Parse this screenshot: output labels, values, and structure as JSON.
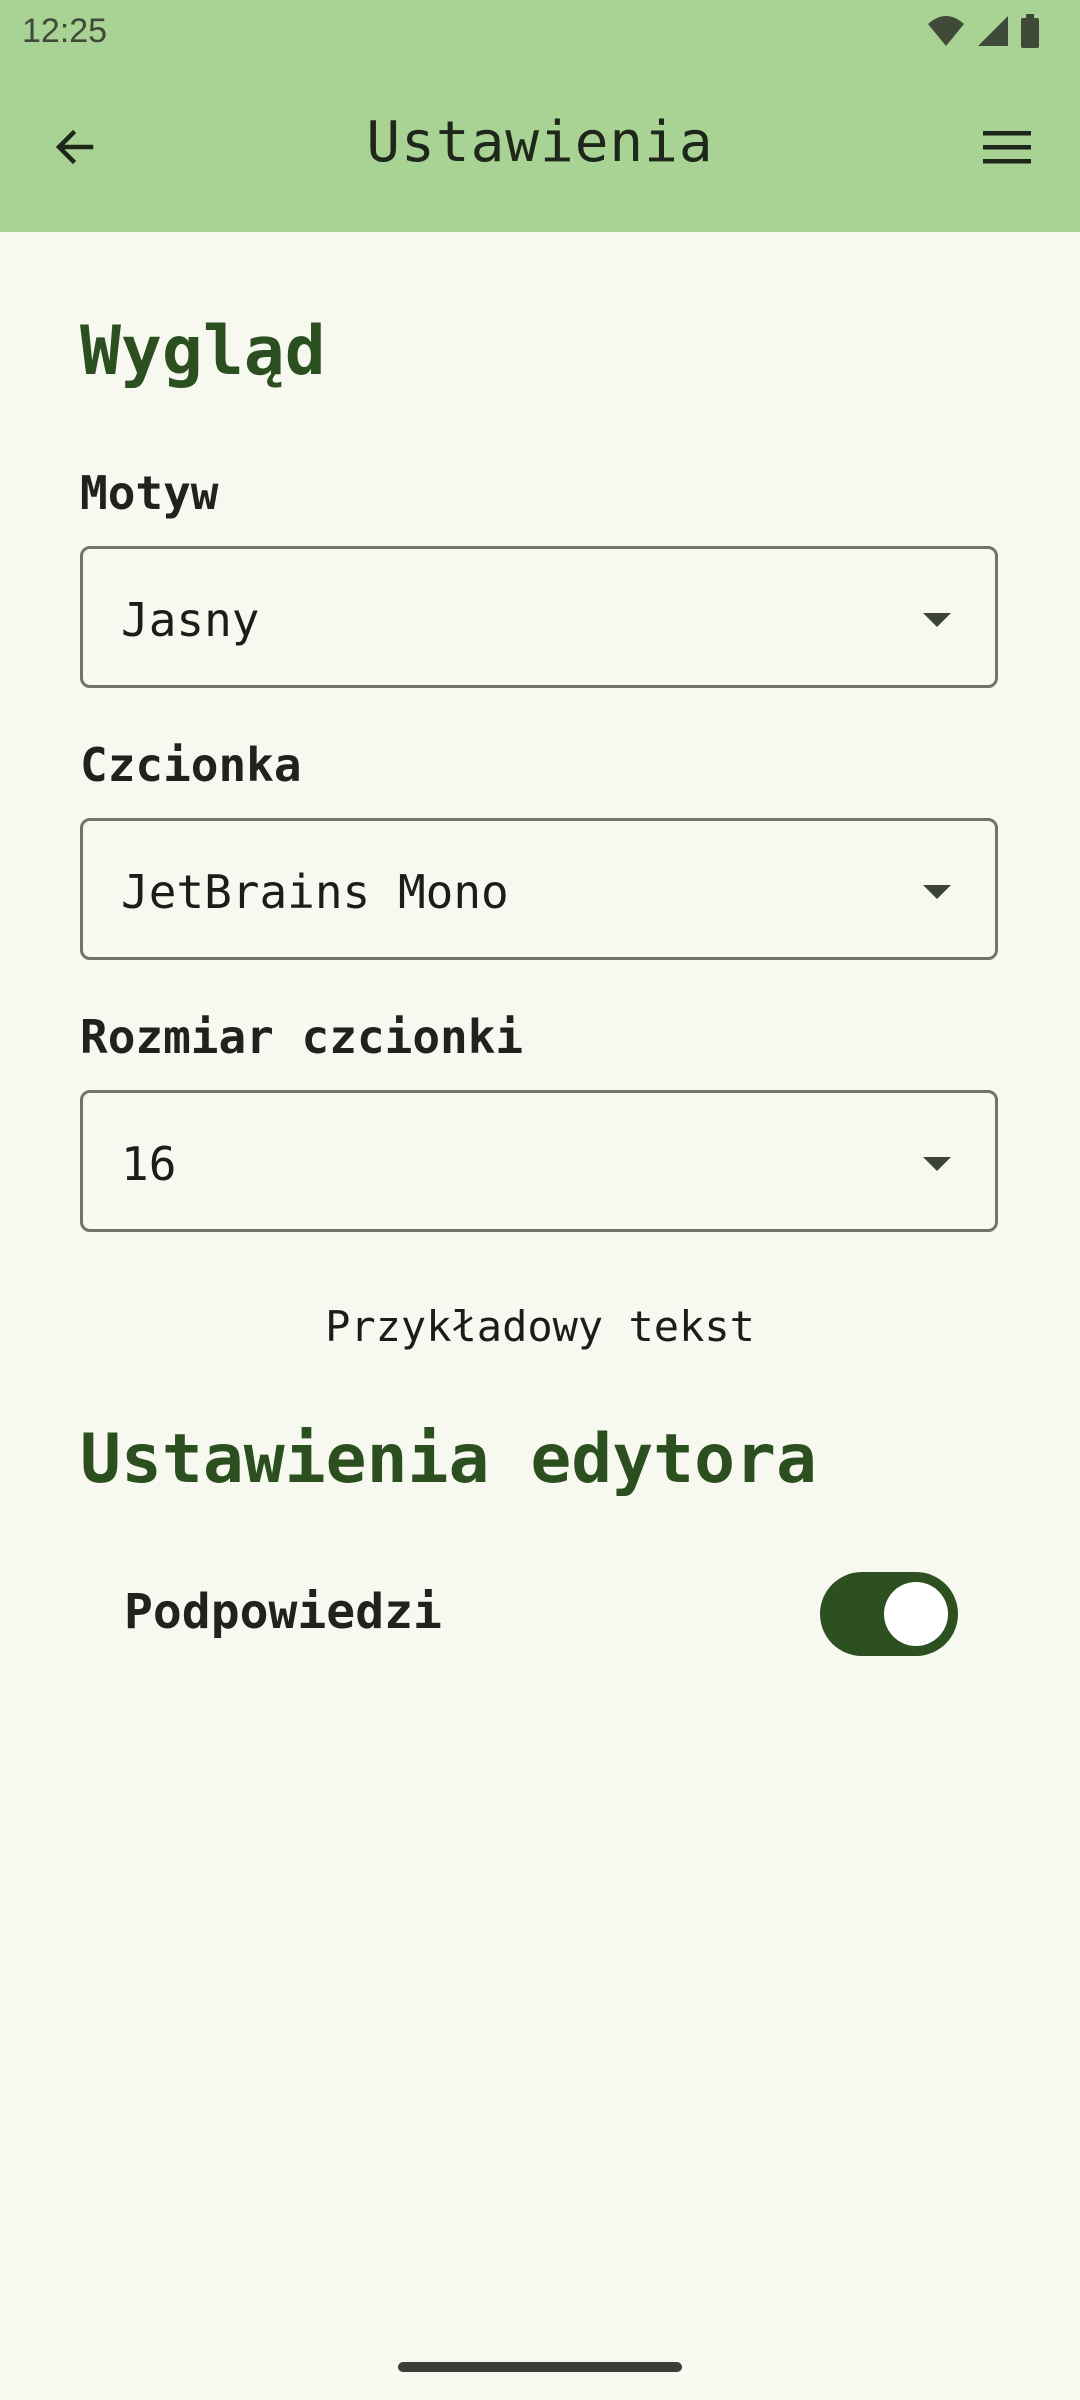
{
  "status_bar": {
    "time": "12:25",
    "icons": [
      "wifi-icon",
      "cell-signal-icon",
      "battery-icon"
    ]
  },
  "app_bar": {
    "title": "Ustawienia",
    "back_icon": "arrow-left-icon",
    "menu_icon": "hamburger-menu-icon"
  },
  "appearance": {
    "section_title": "Wygląd",
    "theme": {
      "label": "Motyw",
      "value": "Jasny"
    },
    "font": {
      "label": "Czcionka",
      "value": "JetBrains Mono"
    },
    "font_size": {
      "label": "Rozmiar czcionki",
      "value": "16"
    },
    "sample_text": "Przykładowy tekst"
  },
  "editor": {
    "section_title": "Ustawienia edytora",
    "hints": {
      "label": "Podpowiedzi",
      "enabled": true
    }
  },
  "colors": {
    "app_bar": "#a8d394",
    "background": "#f7f8f0",
    "accent": "#2d5020",
    "section_title": "#2c4f1f"
  }
}
